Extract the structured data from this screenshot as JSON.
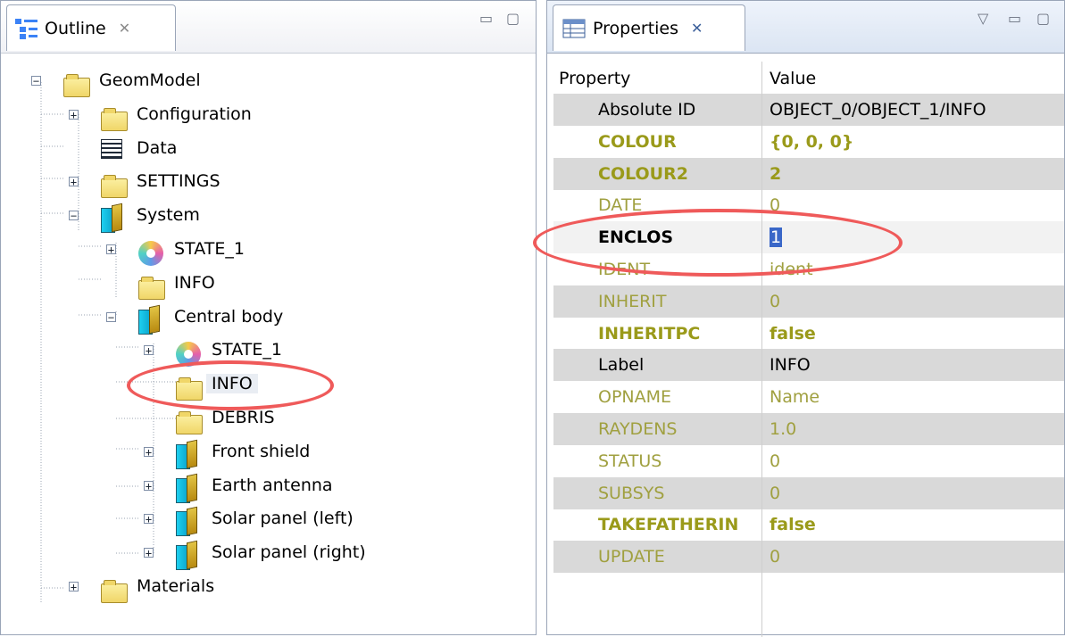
{
  "outline": {
    "tab_title": "Outline",
    "tree": [
      {
        "label": "GeomModel",
        "icon": "folder-icon",
        "expander": "minus"
      },
      {
        "label": "Configuration",
        "icon": "folder-icon",
        "expander": "plus"
      },
      {
        "label": "Data",
        "icon": "data-table-icon",
        "expander": ""
      },
      {
        "label": "SETTINGS",
        "icon": "folder-icon",
        "expander": "plus"
      },
      {
        "label": "System",
        "icon": "system-component-icon",
        "expander": "minus"
      },
      {
        "label": "STATE_1",
        "icon": "state-icon",
        "expander": "plus"
      },
      {
        "label": "INFO",
        "icon": "folder-icon",
        "expander": ""
      },
      {
        "label": "Central body",
        "icon": "system-component-icon",
        "expander": "minus"
      },
      {
        "label": "STATE_1",
        "icon": "state-icon",
        "expander": "plus"
      },
      {
        "label": "INFO",
        "icon": "folder-icon",
        "expander": ""
      },
      {
        "label": "DEBRIS",
        "icon": "folder-icon",
        "expander": ""
      },
      {
        "label": "Front shield",
        "icon": "system-component-icon",
        "expander": "plus"
      },
      {
        "label": "Earth antenna",
        "icon": "system-component-icon",
        "expander": "plus"
      },
      {
        "label": "Solar panel (left)",
        "icon": "system-component-icon",
        "expander": "plus"
      },
      {
        "label": "Solar panel (right)",
        "icon": "system-component-icon",
        "expander": "plus"
      },
      {
        "label": "Materials",
        "icon": "folder-icon",
        "expander": "plus"
      }
    ]
  },
  "properties": {
    "tab_title": "Properties",
    "column_property": "Property",
    "column_value": "Value",
    "rows": [
      {
        "name": "Absolute ID",
        "value": "OBJECT_0/OBJECT_1/INFO",
        "style": "normal"
      },
      {
        "name": "COLOUR",
        "value": "{0, 0, 0}",
        "style": "olive-bold"
      },
      {
        "name": "COLOUR2",
        "value": "2",
        "style": "olive-bold"
      },
      {
        "name": "DATE",
        "value": "0",
        "style": "olive"
      },
      {
        "name": "ENCLOS",
        "value": "1",
        "style": "bold-editing"
      },
      {
        "name": "IDENT",
        "value": "ident",
        "style": "olive"
      },
      {
        "name": "INHERIT",
        "value": "0",
        "style": "olive"
      },
      {
        "name": "INHERITPC",
        "value": "false",
        "style": "olive-bold"
      },
      {
        "name": "Label",
        "value": "INFO",
        "style": "normal"
      },
      {
        "name": "OPNAME",
        "value": "Name",
        "style": "olive"
      },
      {
        "name": "RAYDENS",
        "value": "1.0",
        "style": "olive"
      },
      {
        "name": "STATUS",
        "value": "0",
        "style": "olive"
      },
      {
        "name": "SUBSYS",
        "value": "0",
        "style": "olive"
      },
      {
        "name": "TAKEFATHERIN",
        "value": "false",
        "style": "olive-bold"
      },
      {
        "name": "UPDATE",
        "value": "0",
        "style": "olive"
      }
    ]
  },
  "colors": {
    "annotation_red": "#ef5a5a",
    "olive_text": "#9a9a1a",
    "alt_row_gray": "#d9d9d9"
  }
}
